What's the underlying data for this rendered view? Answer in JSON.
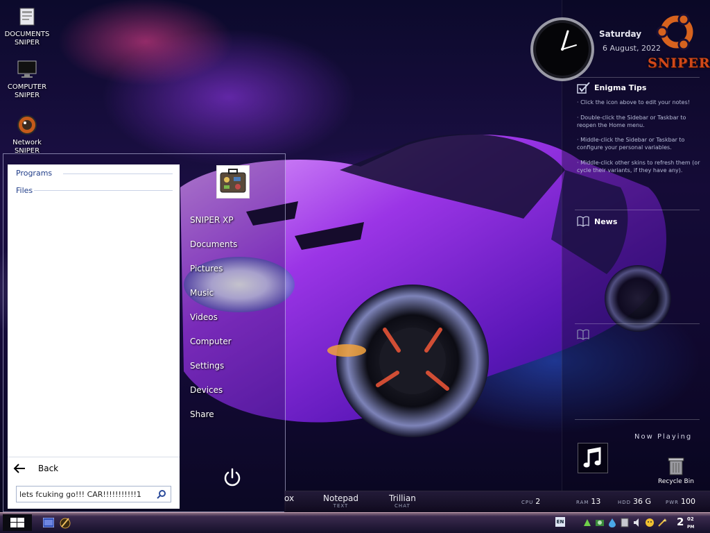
{
  "desktop": {
    "icons": [
      {
        "label": "DOCUMENTS\nSNIPER",
        "icon": "documents-icon"
      },
      {
        "label": "COMPUTER\nSNIPER",
        "icon": "computer-icon"
      },
      {
        "label": "Network\nSNIPER",
        "icon": "network-icon"
      }
    ]
  },
  "start_menu": {
    "sections": [
      "Programs",
      "Files"
    ],
    "back_label": "Back",
    "search_value": "lets fcuking go!!! CAR!!!!!!!!!!!1",
    "right_items": [
      "SNIPER XP",
      "Documents",
      "Pictures",
      "Music",
      "Videos",
      "Computer",
      "Settings",
      "Devices",
      "Share"
    ]
  },
  "sidebar": {
    "day": "Saturday",
    "date": "6 August, 2022",
    "brand": "SNIPER",
    "tips_title": "Enigma Tips",
    "tips": [
      "· Click the icon above to edit your notes!",
      "· Double-click the Sidebar or Taskbar to reopen the Home menu.",
      "· Middle-click the Sidebar or Taskbar to configure your personal variables.",
      "· Middle-click other skins to refresh them (or cycle their variants, if they have any)."
    ],
    "news_title": "News",
    "now_playing": "Now Playing",
    "recycle_label": "Recycle Bin"
  },
  "dock": {
    "partial": "ox",
    "apps": [
      {
        "name": "Notepad",
        "sub": "TEXT"
      },
      {
        "name": "Trillian",
        "sub": "CHAT"
      }
    ],
    "stats": [
      {
        "key": "CPU",
        "value": "2"
      },
      {
        "key": "RAM",
        "value": "13"
      },
      {
        "key": "HDD",
        "value": "36 G"
      },
      {
        "key": "PWR",
        "value": "100"
      }
    ]
  },
  "taskbar": {
    "lang": "EN",
    "hour": "2",
    "minute": "02",
    "ampm": "PM"
  },
  "colors": {
    "start_text": "#1f3c88",
    "brand": "#d0481a"
  }
}
